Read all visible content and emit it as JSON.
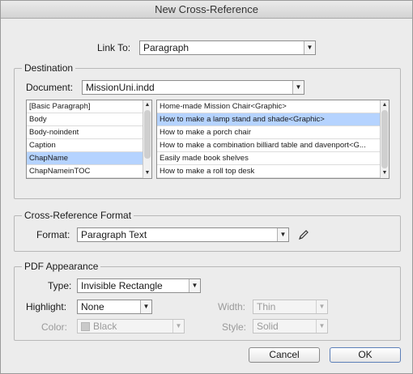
{
  "window": {
    "title": "New Cross-Reference"
  },
  "link_to": {
    "label": "Link To:",
    "value": "Paragraph"
  },
  "destination": {
    "title": "Destination",
    "document_label": "Document:",
    "document_value": "MissionUni.indd",
    "styles": [
      {
        "label": "[Basic Paragraph]",
        "selected": false
      },
      {
        "label": "Body",
        "selected": false
      },
      {
        "label": "Body-noindent",
        "selected": false
      },
      {
        "label": "Caption",
        "selected": false
      },
      {
        "label": "ChapName",
        "selected": true
      },
      {
        "label": "ChapNameinTOC",
        "selected": false
      }
    ],
    "paragraphs": [
      {
        "label": "Home-made Mission Chair<Graphic>",
        "selected": false
      },
      {
        "label": "How to make a lamp stand and shade<Graphic>",
        "selected": true
      },
      {
        "label": "How to make a porch chair",
        "selected": false
      },
      {
        "label": "How to make a combination billiard table and davenport<G...",
        "selected": false
      },
      {
        "label": "Easily made book shelves",
        "selected": false
      },
      {
        "label": "How to make a roll top desk",
        "selected": false
      }
    ]
  },
  "xref_format": {
    "title": "Cross-Reference Format",
    "format_label": "Format:",
    "format_value": "Paragraph Text",
    "edit_icon": "pencil-icon"
  },
  "pdf": {
    "title": "PDF Appearance",
    "type_label": "Type:",
    "type_value": "Invisible Rectangle",
    "highlight_label": "Highlight:",
    "highlight_value": "None",
    "width_label": "Width:",
    "width_value": "Thin",
    "color_label": "Color:",
    "color_value": "Black",
    "style_label": "Style:",
    "style_value": "Solid"
  },
  "buttons": {
    "cancel": "Cancel",
    "ok": "OK"
  }
}
